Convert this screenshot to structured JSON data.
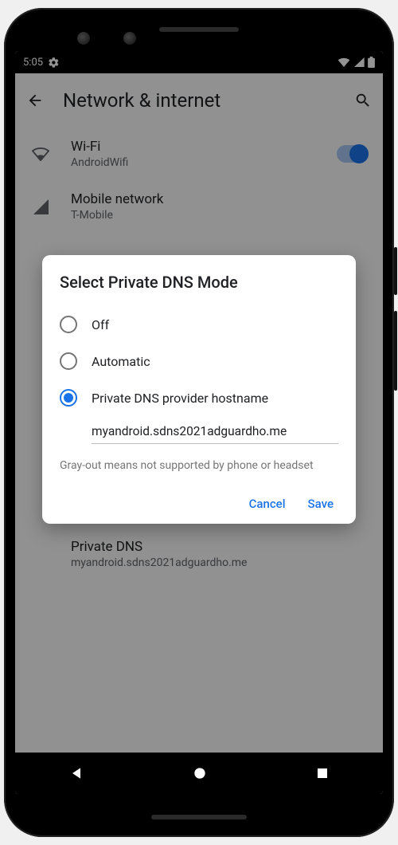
{
  "statusbar": {
    "time": "5:05"
  },
  "appbar": {
    "title": "Network & internet"
  },
  "items": {
    "wifi": {
      "primary": "Wi-Fi",
      "secondary": "AndroidWifi"
    },
    "mobile": {
      "primary": "Mobile network",
      "secondary": "T-Mobile"
    },
    "private_dns": {
      "primary": "Private DNS",
      "secondary": "myandroid.sdns2021adguardho.me"
    }
  },
  "dialog": {
    "title": "Select Private DNS Mode",
    "options": {
      "off": "Off",
      "auto": "Automatic",
      "hostname": "Private DNS provider hostname"
    },
    "hostname_value": "myandroid.sdns2021adguardho.me",
    "hint": "Gray-out means not supported by phone or headset",
    "cancel": "Cancel",
    "save": "Save"
  }
}
